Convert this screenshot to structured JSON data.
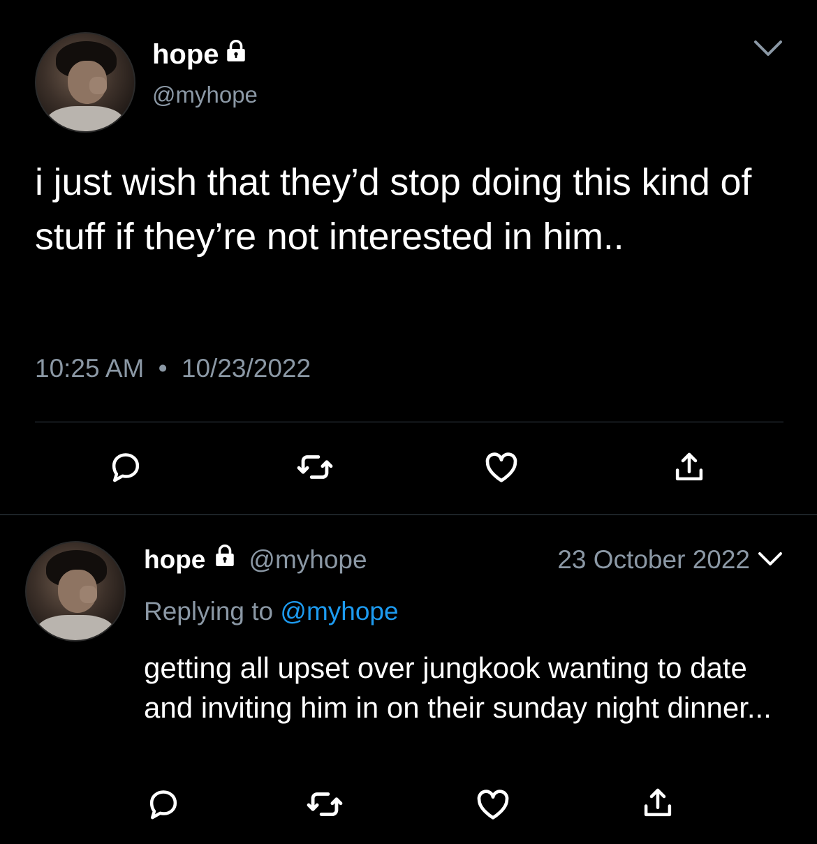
{
  "main_tweet": {
    "display_name": "hope",
    "handle": "@myhope",
    "text": "i just wish that they’d stop doing this kind of stuff if they’re not interested in him..",
    "time": "10:25 AM",
    "separator": "•",
    "date": "10/23/2022",
    "actions": [
      "reply-icon",
      "retweet-icon",
      "like-icon",
      "share-icon"
    ]
  },
  "reply_tweet": {
    "display_name": "hope",
    "handle": "@myhope",
    "date": "23 October 2022",
    "replying_prefix": "Replying to",
    "replying_to": "@myhope",
    "text": "getting all upset over jungkook wanting to date and inviting him in on their sunday night dinner...",
    "actions": [
      "reply-icon",
      "retweet-icon",
      "like-icon",
      "share-icon"
    ]
  },
  "colors": {
    "background": "#000000",
    "text": "#ffffff",
    "secondary": "#8b98a5",
    "link": "#1d9bf0",
    "divider": "#38444d"
  }
}
